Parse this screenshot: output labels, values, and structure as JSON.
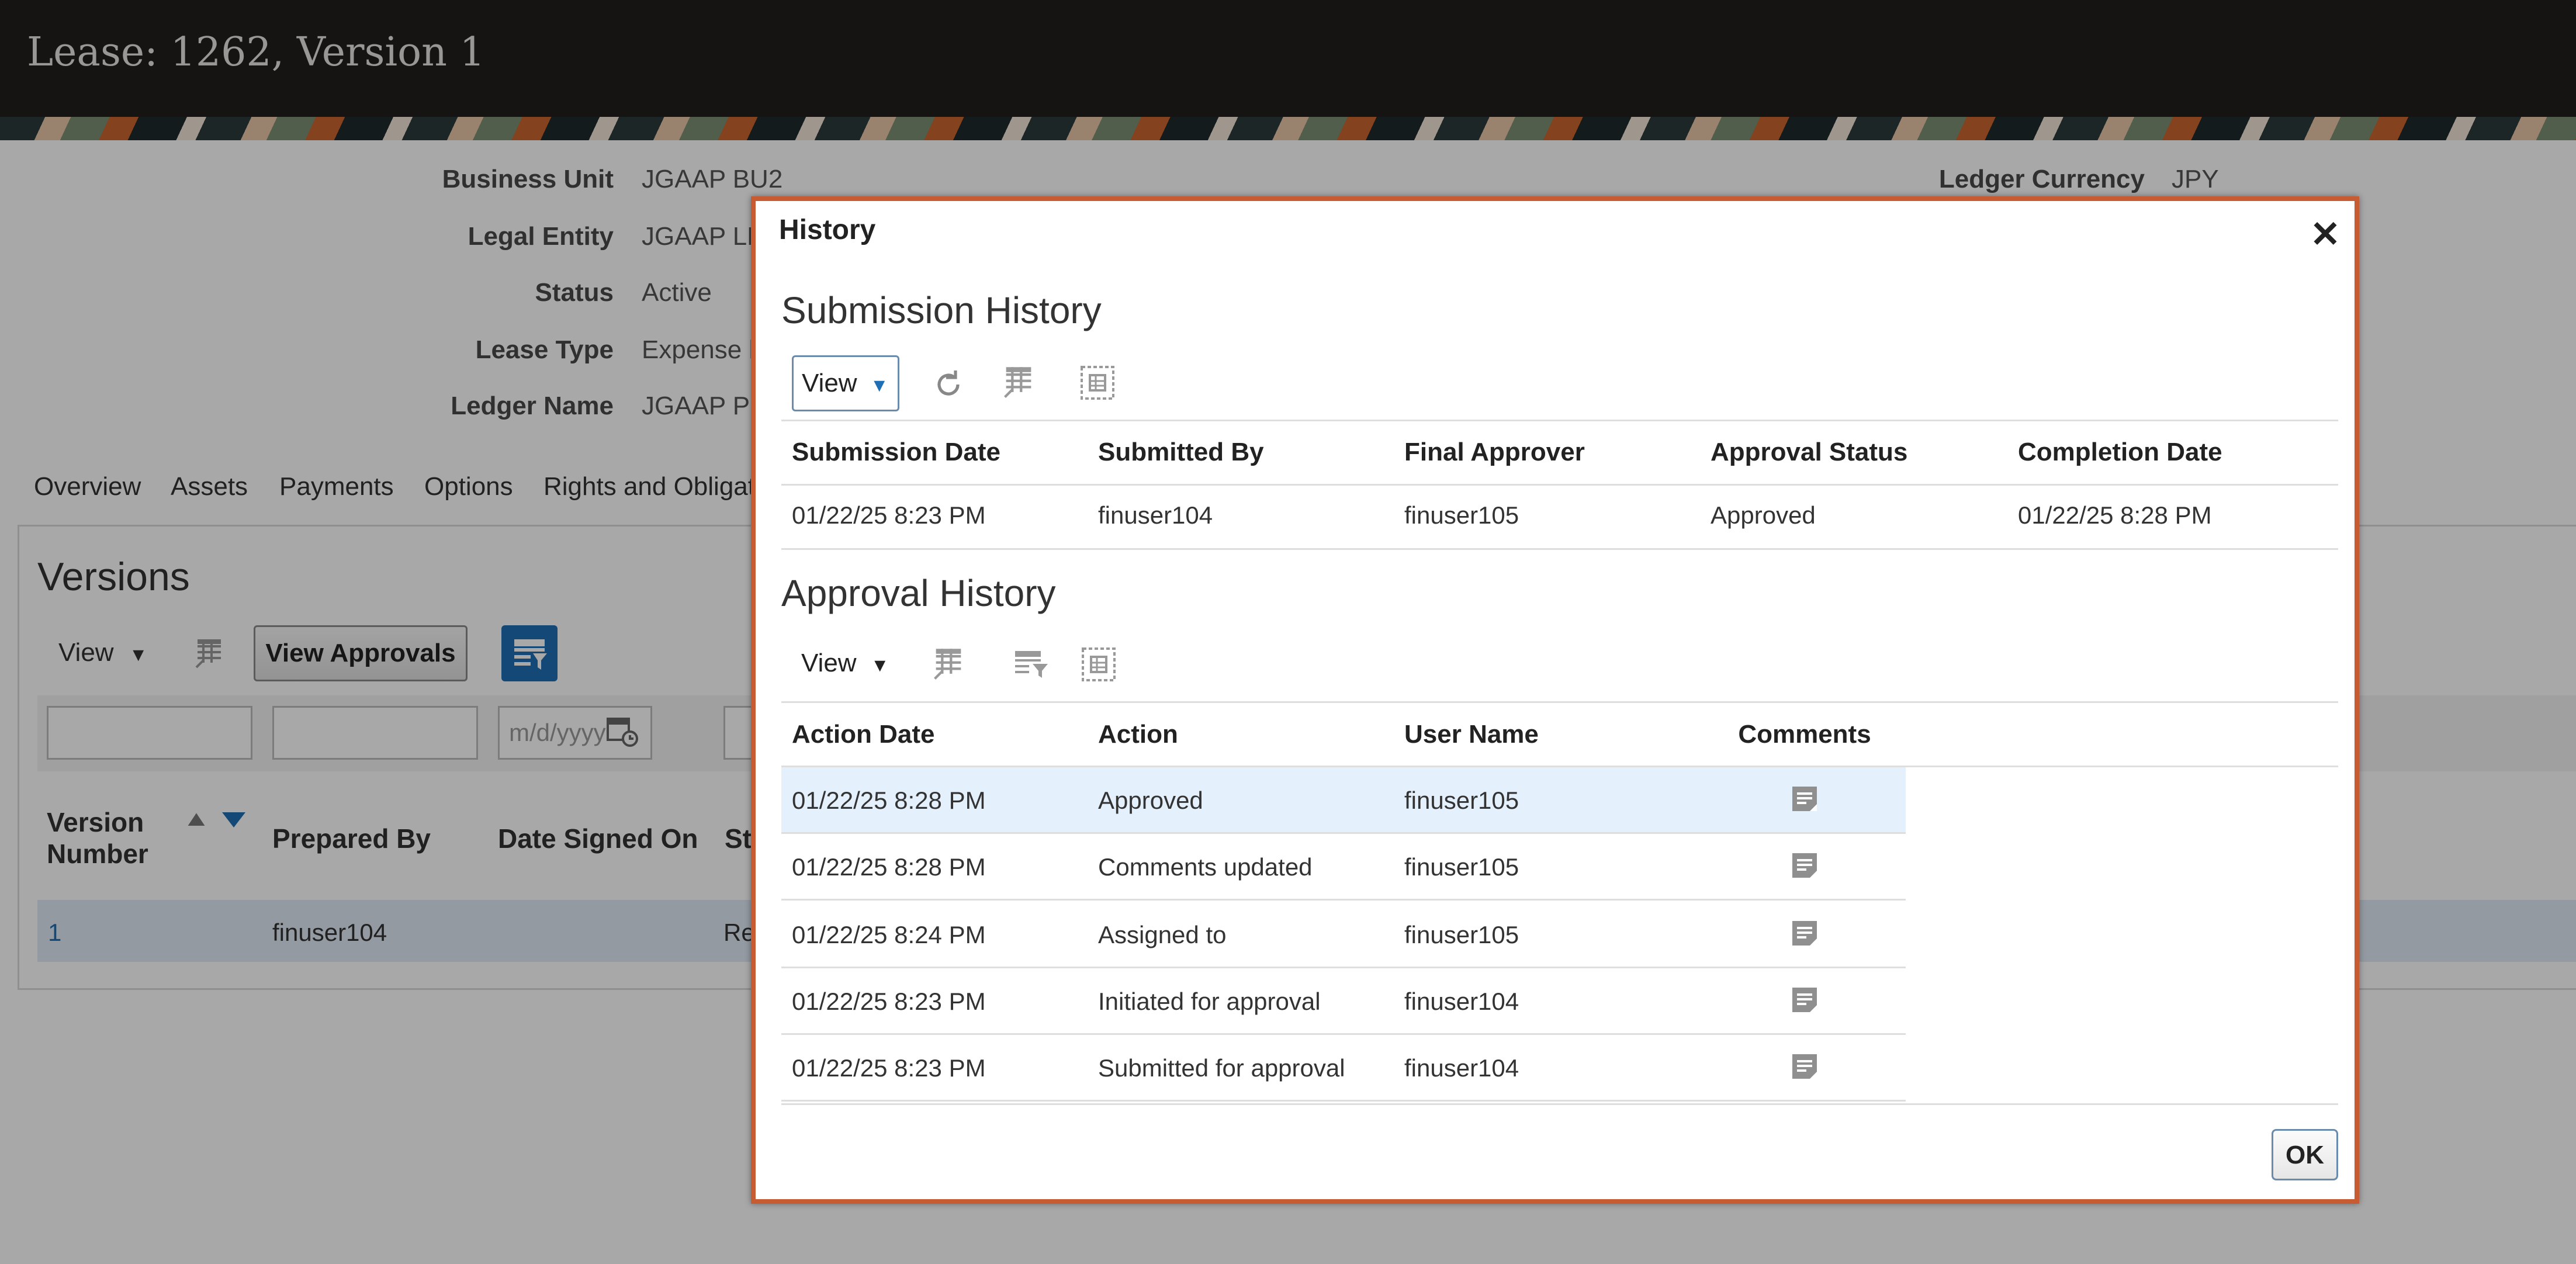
{
  "window": {
    "title": "Lease: 1262, Version 1"
  },
  "details": [
    {
      "label": "Business Unit",
      "value": "JGAAP BU2"
    },
    {
      "label": "Legal Entity",
      "value": "JGAAP LE"
    },
    {
      "label": "Status",
      "value": "Active"
    },
    {
      "label": "Lease Type",
      "value": "Expense l"
    },
    {
      "label": "Ledger Name",
      "value": "JGAAP P"
    }
  ],
  "ledger_currency": {
    "label": "Ledger Currency",
    "value": "JPY"
  },
  "tabs": [
    "Overview",
    "Assets",
    "Payments",
    "Options",
    "Rights and Obligatio"
  ],
  "versions": {
    "title": "Versions",
    "view_label": "View",
    "view_approvals_label": "View Approvals",
    "date_placeholder": "m/d/yyyy",
    "columns": {
      "version": "Version Number",
      "prepared_by": "Prepared By",
      "date_signed": "Date Signed On",
      "status_partial": "St"
    },
    "row": {
      "version": "1",
      "prepared_by": "finuser104",
      "status_partial": "Re"
    }
  },
  "dialog": {
    "title": "History",
    "close_icon": "close-icon",
    "submission": {
      "title": "Submission History",
      "view_label": "View",
      "columns": [
        "Submission Date",
        "Submitted By",
        "Final Approver",
        "Approval Status",
        "Completion Date"
      ],
      "rows": [
        [
          "01/22/25 8:23 PM",
          "finuser104",
          "finuser105",
          "Approved",
          "01/22/25 8:28 PM"
        ]
      ]
    },
    "approval": {
      "title": "Approval History",
      "view_label": "View",
      "columns": [
        "Action Date",
        "Action",
        "User Name",
        "Comments"
      ],
      "rows": [
        [
          "01/22/25 8:28 PM",
          "Approved",
          "finuser105"
        ],
        [
          "01/22/25 8:28 PM",
          "Comments updated",
          "finuser105"
        ],
        [
          "01/22/25 8:24 PM",
          "Assigned to",
          "finuser105"
        ],
        [
          "01/22/25 8:23 PM",
          "Initiated for approval",
          "finuser104"
        ],
        [
          "01/22/25 8:23 PM",
          "Submitted for approval",
          "finuser104"
        ]
      ]
    },
    "ok_label": "OK"
  },
  "colors": {
    "accent": "#c75c32",
    "selected_row": "#e4f0fb",
    "link": "#1f6fb5",
    "filter_button": "#1f6fb5"
  }
}
